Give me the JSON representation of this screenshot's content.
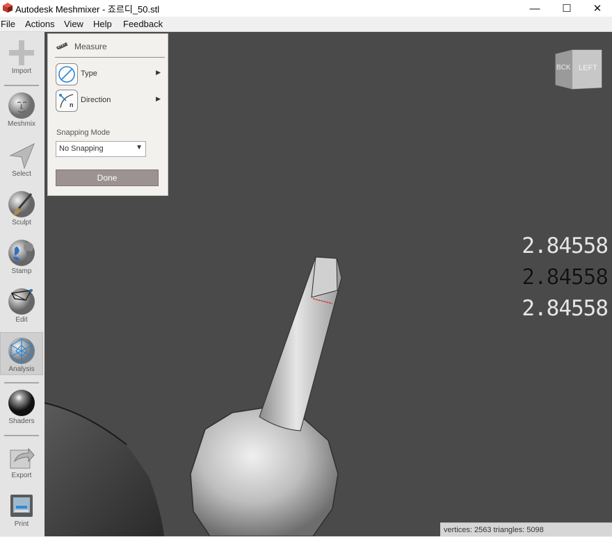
{
  "window": {
    "title": "Autodesk Meshmixer - 죠르디_50.stl",
    "controls": [
      "—",
      "☐",
      "✕"
    ]
  },
  "menubar": {
    "items": [
      "File",
      "Actions",
      "View",
      "Help",
      "Feedback"
    ]
  },
  "toolbar": {
    "items": [
      {
        "label": "Import",
        "icon": "plus-icon"
      },
      {
        "label": "Meshmix",
        "icon": "head-icon"
      },
      {
        "label": "Select",
        "icon": "arrow-select-icon"
      },
      {
        "label": "Sculpt",
        "icon": "brush-icon"
      },
      {
        "label": "Stamp",
        "icon": "stamp-icon"
      },
      {
        "label": "Edit",
        "icon": "edit-mesh-icon"
      },
      {
        "label": "Analysis",
        "icon": "analysis-icon",
        "active": true
      },
      {
        "label": "Shaders",
        "icon": "shader-sphere-icon"
      },
      {
        "label": "Export",
        "icon": "export-icon"
      },
      {
        "label": "Print",
        "icon": "printer-icon"
      }
    ]
  },
  "measure_panel": {
    "title": "Measure",
    "type_label": "Type",
    "direction_label": "Direction",
    "direction_icon_letter": "n",
    "snapping_label": "Snapping Mode",
    "snapping_value": "No Snapping",
    "done_label": "Done"
  },
  "view_cube": {
    "face_label": "LEFT",
    "side_label": "BCK"
  },
  "measurements": {
    "values": [
      "2.84558",
      "2.84558",
      "2.84558"
    ],
    "colors": [
      "#e6e6e6",
      "#111111",
      "#e6e6e6"
    ]
  },
  "status": {
    "text": "vertices: 2563  triangles: 5098"
  },
  "colors": {
    "viewport_bg": "#4a4a4a",
    "panel_bg": "#f3f1ee",
    "done_button": "#9b9291"
  }
}
